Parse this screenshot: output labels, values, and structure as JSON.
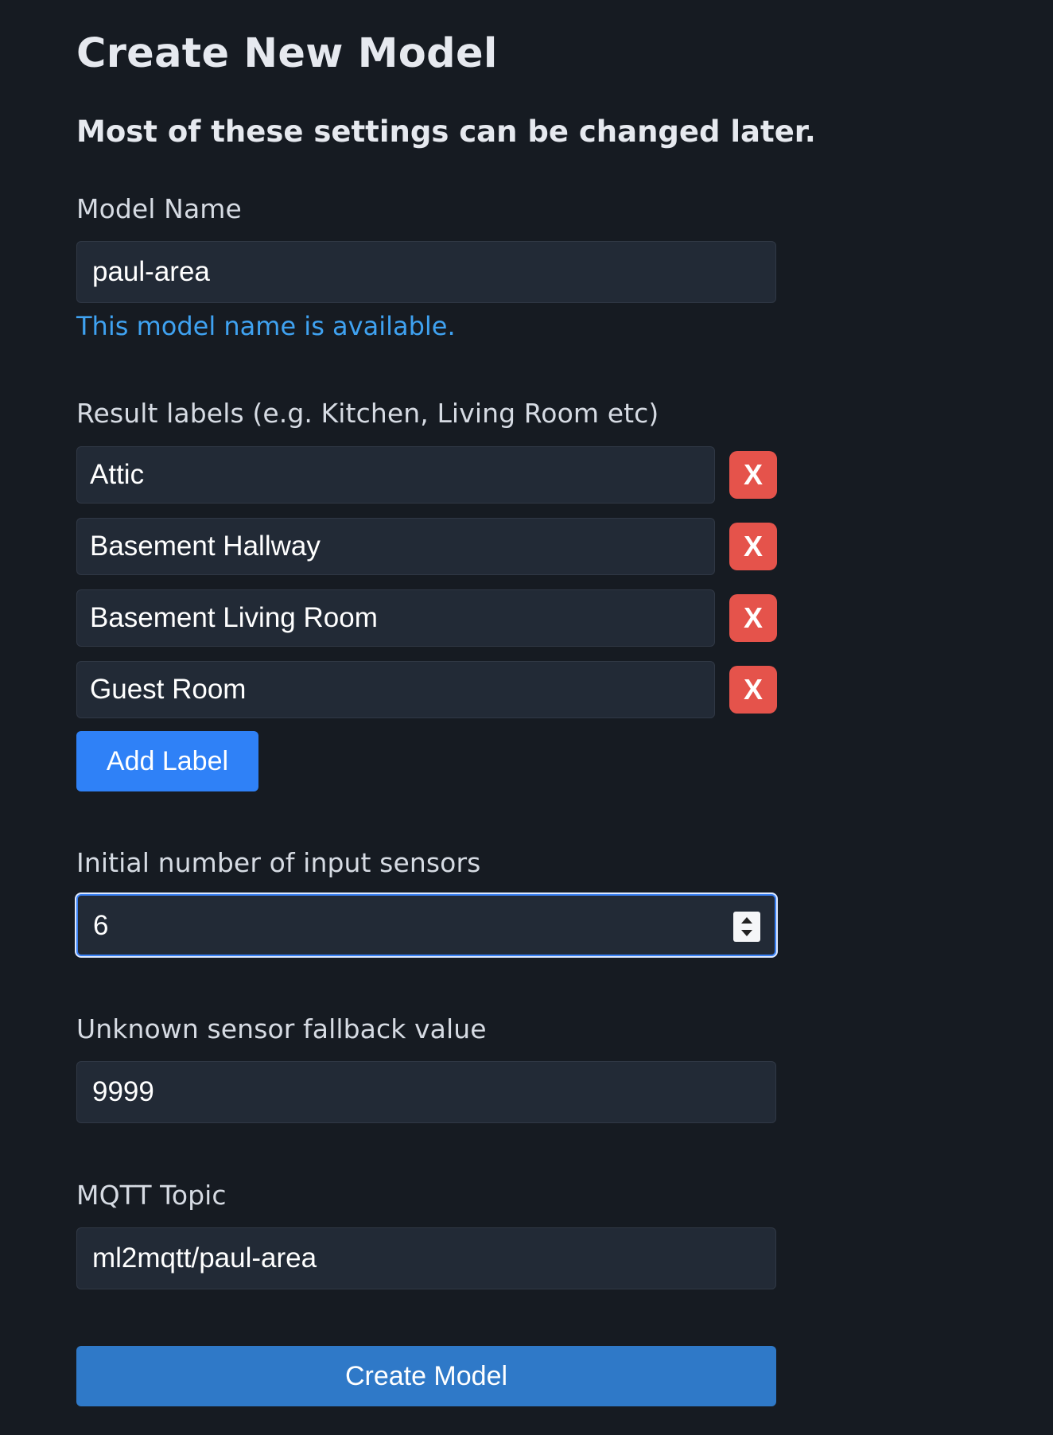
{
  "page": {
    "title": "Create New Model",
    "subtitle": "Most of these settings can be changed later."
  },
  "model_name": {
    "label": "Model Name",
    "value": "paul-area",
    "hint": "This model name is available."
  },
  "result_labels": {
    "label": "Result labels (e.g. Kitchen, Living Room etc)",
    "items": [
      {
        "value": "Attic",
        "remove_label": "X"
      },
      {
        "value": "Basement Hallway",
        "remove_label": "X"
      },
      {
        "value": "Basement Living Room",
        "remove_label": "X"
      },
      {
        "value": "Guest Room",
        "remove_label": "X"
      }
    ],
    "add_button": "Add Label"
  },
  "sensors": {
    "label": "Initial number of input sensors",
    "value": "6"
  },
  "fallback": {
    "label": "Unknown sensor fallback value",
    "value": "9999"
  },
  "mqtt": {
    "label": "MQTT Topic",
    "value": "ml2mqtt/paul-area"
  },
  "submit_button": "Create Model",
  "colors": {
    "background": "#161b22",
    "input_bg": "#222a36",
    "hint": "#3fa2f1",
    "remove": "#e5534b",
    "primary": "#2f81f7",
    "submit": "#2f79c8"
  }
}
